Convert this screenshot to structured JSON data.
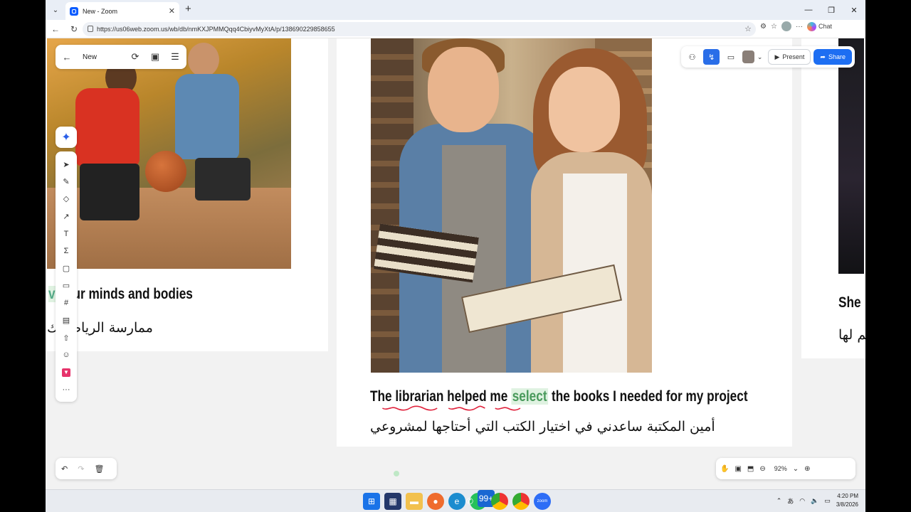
{
  "browser": {
    "tab_title": "New - Zoom",
    "url": "https://us06web.zoom.us/wb/db/nmKXJPMMQqq4CbiyvMyXtA/p/138690229858655",
    "chat_label": "Chat"
  },
  "whiteboard": {
    "title": "New",
    "present_label": "Present",
    "share_label": "Share",
    "zoom_level": "92%"
  },
  "cards": {
    "left": {
      "caption_en_prefix": "va",
      "caption_en": "our minds and bodies",
      "caption_ar": "ممارسة الرياضة ك"
    },
    "middle": {
      "caption_en_before": "The librarian helped me",
      "caption_en_highlight": "select",
      "caption_en_after": "the books I needed for my project",
      "caption_ar": "أمين المكتبة ساعدني في اختيار الكتب التي أحتاجها لمشروعي"
    },
    "right": {
      "caption_en": "She",
      "caption_ar": "هم لها"
    }
  },
  "taskbar": {
    "whatsapp_badge": "99+",
    "time": "4:20 PM",
    "date": "3/8/2026"
  },
  "colors": {
    "accent": "#1d6ef2",
    "highlight_bg": "#dff2e1",
    "squiggle": "#e0213b"
  }
}
